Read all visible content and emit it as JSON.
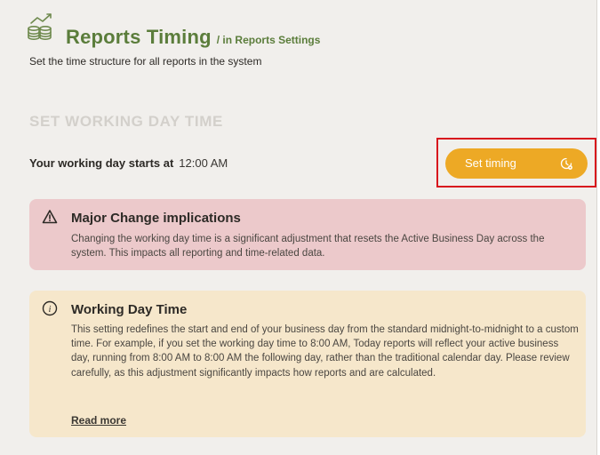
{
  "header": {
    "logo_icon": "coins-growth-icon",
    "title": "Reports Timing",
    "breadcrumb": "/ in Reports Settings",
    "subtitle": "Set the time structure for all reports in the system"
  },
  "section": {
    "title": "SET WORKING DAY TIME"
  },
  "working_day": {
    "label": "Your working day starts at",
    "value": "12:00 AM",
    "button_label": "Set timing",
    "button_icon": "clock-settings-icon"
  },
  "warning_card": {
    "icon": "warning-triangle-icon",
    "title": "Major Change implications",
    "body": "Changing the working day time is a significant adjustment that resets the Active Business Day across the system. This impacts all reporting and time-related data."
  },
  "info_card": {
    "icon": "info-circle-icon",
    "title": "Working Day Time",
    "body": "This setting redefines the start and end of your business day from the standard midnight-to-midnight to a custom time. For example, if you set the working day time to 8:00 AM, Today reports will reflect your active business day, running from 8:00 AM to 8:00 AM the following day, rather than the traditional calendar day. Please review carefully, as this adjustment significantly impacts how reports and are calculated.",
    "link_label": "Read more"
  },
  "colors": {
    "brand_green": "#5b7d3b",
    "accent_orange": "#eda925",
    "danger_bg": "#ecc9cb",
    "info_bg": "#f6e7cb",
    "highlight_red": "#d8161d"
  }
}
